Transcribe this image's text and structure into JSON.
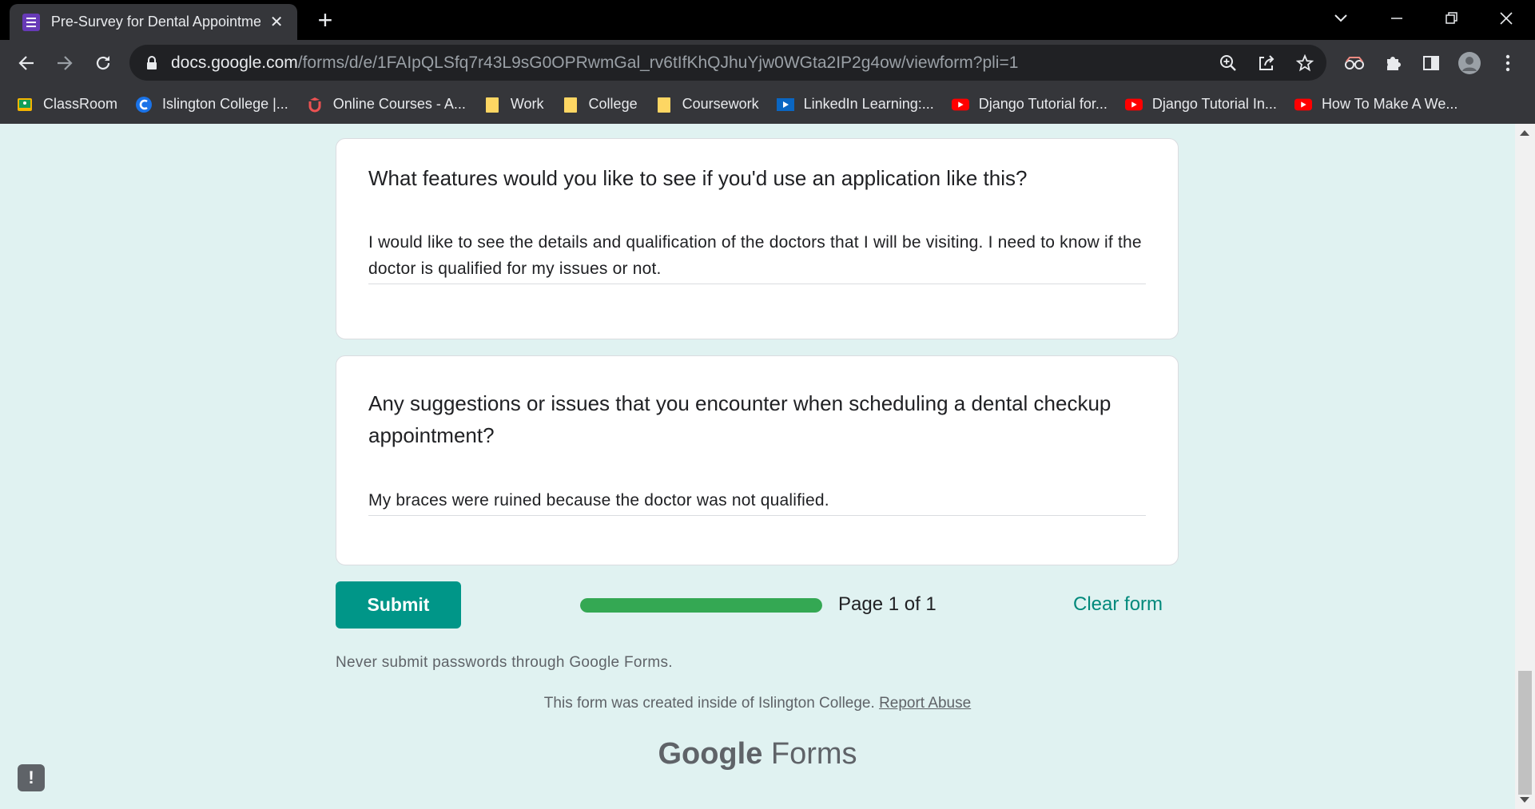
{
  "browser": {
    "tab_title": "Pre-Survey for Dental Appointme",
    "new_tab_symbol": "+",
    "close_symbol": "✕",
    "url_host": "docs.google.com",
    "url_path": "/forms/d/e/1FAIpQLSfq7r43L9sG0OPRwmGal_rv6tIfKhQJhuYjw0WGta2IP2g4ow/viewform?pli=1",
    "bookmarks": [
      {
        "label": "ClassRoom",
        "icon": "classroom-icon",
        "color": "#f4b400"
      },
      {
        "label": "Islington College |...",
        "icon": "islington-icon",
        "color": "#1a73e8"
      },
      {
        "label": "Online Courses - A...",
        "icon": "udemy-icon",
        "color": "#ec5252"
      },
      {
        "label": "Work",
        "icon": "folder-icon",
        "color": "#fdd663"
      },
      {
        "label": "College",
        "icon": "folder-icon",
        "color": "#fdd663"
      },
      {
        "label": "Coursework",
        "icon": "folder-icon",
        "color": "#fdd663"
      },
      {
        "label": "LinkedIn Learning:...",
        "icon": "linkedin-learning-icon",
        "color": "#0a66c2"
      },
      {
        "label": "Django Tutorial for...",
        "icon": "youtube-icon",
        "color": "#ff0000"
      },
      {
        "label": "Django Tutorial In...",
        "icon": "youtube-icon",
        "color": "#ff0000"
      },
      {
        "label": "How To Make A We...",
        "icon": "youtube-icon",
        "color": "#ff0000"
      }
    ]
  },
  "form": {
    "questions": [
      {
        "title": "What features would you like to see if you'd use an application like this?",
        "answer": "I would like to see the details and qualification of the doctors that I will be visiting. I need to know if the doctor is qualified for my issues or not."
      },
      {
        "title": "Any suggestions or issues that you encounter when scheduling a dental checkup appointment?",
        "answer": "My braces were ruined because the doctor was not qualified."
      }
    ],
    "submit_label": "Submit",
    "progress_fraction": 1.0,
    "page_indicator": "Page 1 of 1",
    "clear_label": "Clear form",
    "disclaimer": "Never submit passwords through Google Forms.",
    "created_text": "This form was created inside of Islington College. ",
    "report_abuse": "Report Abuse",
    "brand_google": "Google",
    "brand_forms": " Forms",
    "feedback_symbol": "!"
  },
  "colors": {
    "page_bg": "#e0f2f1",
    "accent": "#009688",
    "progress": "#34a853"
  }
}
